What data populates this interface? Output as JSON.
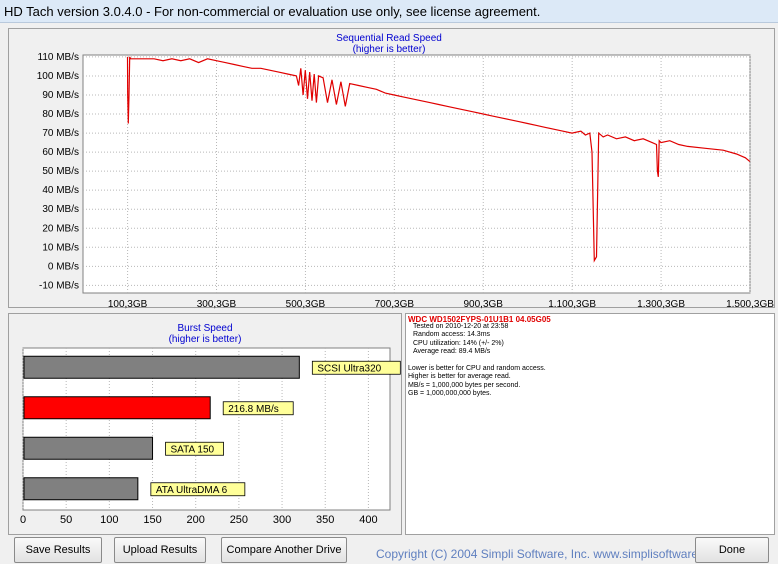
{
  "window": {
    "title": "HD Tach version 3.0.4.0  - For non-commercial or evaluation use only, see license agreement."
  },
  "colors": {
    "read_line": "#e00000",
    "bar_gray": "#808080",
    "bar_red": "#ff0000",
    "label_yellow": "#ffff99",
    "copyright": "#5f7fbf"
  },
  "seq_chart": {
    "title": "Sequential Read Speed",
    "subtitle": "(higher is better)",
    "y_ticks": [
      {
        "v": 110,
        "label": "110 MB/s"
      },
      {
        "v": 100,
        "label": "100 MB/s"
      },
      {
        "v": 90,
        "label": "90 MB/s"
      },
      {
        "v": 80,
        "label": "80 MB/s"
      },
      {
        "v": 70,
        "label": "70 MB/s"
      },
      {
        "v": 60,
        "label": "60 MB/s"
      },
      {
        "v": 50,
        "label": "50 MB/s"
      },
      {
        "v": 40,
        "label": "40 MB/s"
      },
      {
        "v": 30,
        "label": "30 MB/s"
      },
      {
        "v": 20,
        "label": "20 MB/s"
      },
      {
        "v": 10,
        "label": "10 MB/s"
      },
      {
        "v": 0,
        "label": "0 MB/s"
      },
      {
        "v": -10,
        "label": "-10 MB/s"
      }
    ],
    "x_ticks": [
      {
        "v": 100.3,
        "label": "100,3GB"
      },
      {
        "v": 300.3,
        "label": "300,3GB"
      },
      {
        "v": 500.3,
        "label": "500,3GB"
      },
      {
        "v": 700.3,
        "label": "700,3GB"
      },
      {
        "v": 900.3,
        "label": "900,3GB"
      },
      {
        "v": 1100.3,
        "label": "1.100,3GB"
      },
      {
        "v": 1300.3,
        "label": "1.300,3GB"
      },
      {
        "v": 1500.3,
        "label": "1.500,3GB"
      }
    ]
  },
  "chart_data": [
    {
      "type": "line",
      "title": "Sequential Read Speed",
      "subtitle": "(higher is better)",
      "xlabel": "",
      "ylabel": "",
      "xlim": [
        0,
        1500.3
      ],
      "ylim": [
        -14,
        111
      ],
      "grid": true,
      "series": [
        {
          "x": [
            100,
            100.5,
            102,
            103.5,
            105,
            107,
            112,
            140,
            160,
            180,
            200,
            220,
            240,
            260,
            280,
            300,
            320,
            340,
            360,
            380,
            400,
            420,
            440,
            460,
            480,
            485,
            490,
            495,
            500,
            505,
            510,
            515,
            520,
            525,
            530,
            540,
            550,
            560,
            570,
            580,
            590,
            600,
            620,
            640,
            660,
            680,
            700,
            720,
            740,
            760,
            780,
            800,
            820,
            840,
            860,
            880,
            900,
            920,
            940,
            960,
            980,
            1000,
            1020,
            1040,
            1060,
            1080,
            1100,
            1120,
            1130,
            1140,
            1145,
            1150,
            1155,
            1160,
            1170,
            1180,
            1200,
            1220,
            1240,
            1260,
            1280,
            1290,
            1292,
            1294,
            1296,
            1300,
            1320,
            1340,
            1360,
            1400,
            1440,
            1470,
            1490,
            1500
          ],
          "y": [
            110,
            90,
            75,
            90,
            110,
            109,
            109,
            109,
            109,
            108,
            109,
            108,
            109,
            107,
            109,
            108,
            107,
            106,
            105,
            104,
            104,
            103,
            102,
            101,
            100,
            95,
            104,
            90,
            103,
            88,
            102,
            87,
            101,
            86,
            100,
            99,
            86,
            98,
            85,
            97,
            84,
            96,
            95,
            94,
            93,
            91,
            90,
            89,
            88,
            87,
            86,
            85,
            84,
            83,
            82,
            81,
            80,
            79,
            78,
            77,
            76,
            75,
            74,
            73,
            72,
            71,
            70,
            71,
            69,
            70,
            60,
            3,
            5,
            70,
            68,
            69,
            67,
            68,
            66,
            67,
            65,
            64,
            50,
            47,
            66,
            65,
            66,
            64,
            63,
            62,
            61,
            59,
            57,
            55
          ]
        }
      ]
    },
    {
      "type": "bar",
      "title": "Burst Speed",
      "subtitle": "(higher is better)",
      "categories": [
        "SCSI Ultra320",
        "216.8 MB/s",
        "SATA 150",
        "ATA UltraDMA 6"
      ],
      "values": [
        320,
        216.8,
        150,
        133
      ],
      "xlim": [
        0,
        425
      ],
      "x_ticks": [
        0,
        50,
        100,
        150,
        200,
        250,
        300,
        350,
        400
      ],
      "highlight_index": 1
    }
  ],
  "info": {
    "drive": "WDC WD1502FYPS-01U1B1 04.05G05",
    "lines": [
      "Tested on 2010-12-20 at 23:58",
      "Random access: 14.3ms",
      "CPU utilization: 14% (+/- 2%)",
      "Average read: 89.4 MB/s",
      "",
      "Lower is better for CPU and random access.",
      "Higher is better for average read.",
      "MB/s = 1,000,000 bytes per second.",
      "GB = 1,000,000,000 bytes."
    ]
  },
  "buttons": {
    "save": "Save Results",
    "upload": "Upload Results",
    "compare": "Compare Another Drive",
    "done": "Done"
  },
  "copyright": "Copyright (C) 2004 Simpli Software, Inc. www.simplisoftware"
}
